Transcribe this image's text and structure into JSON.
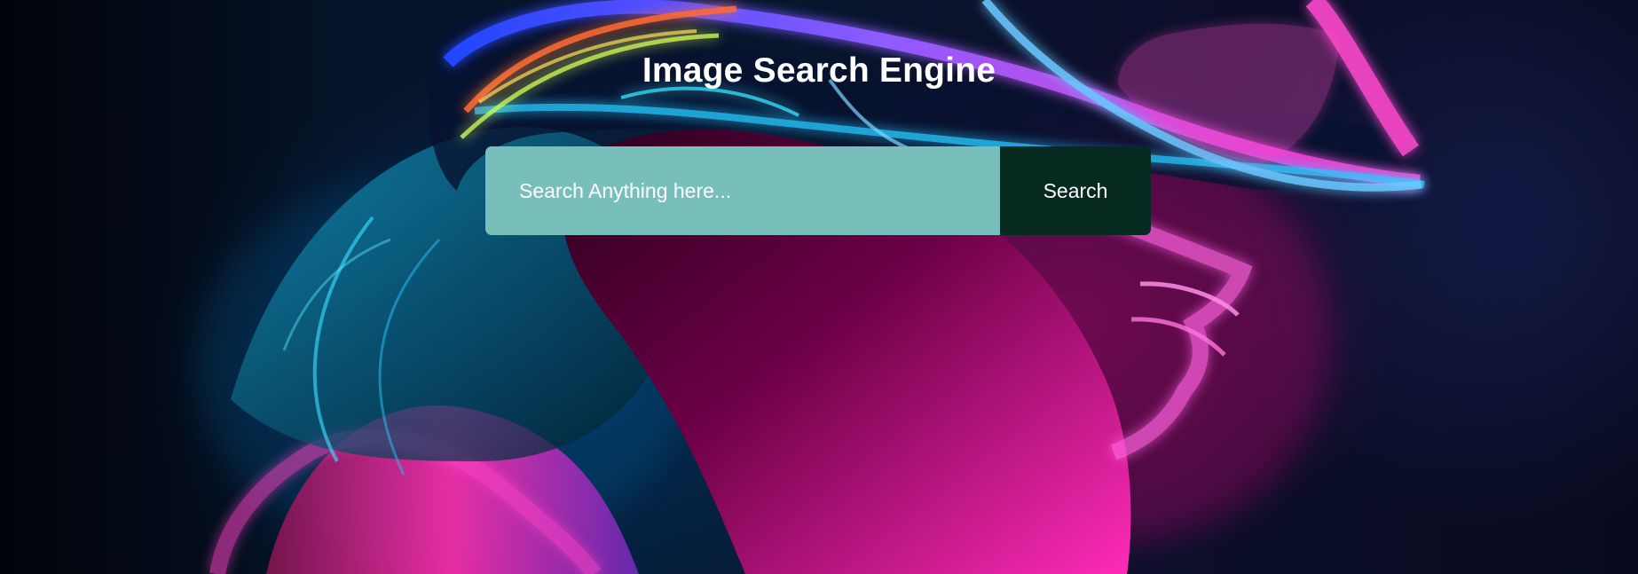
{
  "page": {
    "title": "Image Search Engine"
  },
  "search": {
    "placeholder": "Search Anything here...",
    "button_label": "Search"
  },
  "background": {
    "subject": "neon-vr-headset-portrait",
    "accent_colors": [
      "#ff2bd6",
      "#00d5ff",
      "#ff4a4a",
      "#6a4cff"
    ]
  }
}
